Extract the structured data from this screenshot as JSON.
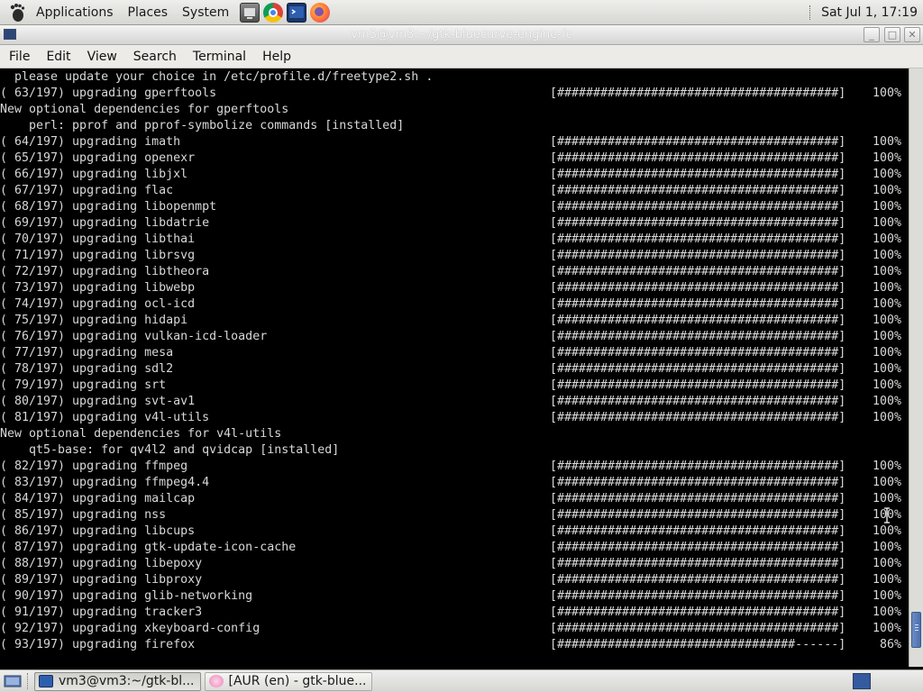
{
  "top_panel": {
    "menus": [
      "Applications",
      "Places",
      "System"
    ],
    "launchers": [
      "file-manager-icon",
      "chrome-icon",
      "terminal-icon",
      "firefox-icon"
    ],
    "clock": "Sat Jul  1, 17:19"
  },
  "window": {
    "title": "vm3@vm3:~/gtk-bluecurve-engine-fc",
    "menubar": [
      "File",
      "Edit",
      "View",
      "Search",
      "Terminal",
      "Help"
    ]
  },
  "terminal": {
    "lines": [
      {
        "text": "  please update your choice in /etc/profile.d/freetype2.sh ."
      },
      {
        "text": "( 63/197) upgrading gperftools",
        "bar": "[#######################################]",
        "pct": "100%"
      },
      {
        "text": "New optional dependencies for gperftools"
      },
      {
        "text": "    perl: pprof and pprof-symbolize commands [installed]"
      },
      {
        "text": "( 64/197) upgrading imath",
        "bar": "[#######################################]",
        "pct": "100%"
      },
      {
        "text": "( 65/197) upgrading openexr",
        "bar": "[#######################################]",
        "pct": "100%"
      },
      {
        "text": "( 66/197) upgrading libjxl",
        "bar": "[#######################################]",
        "pct": "100%"
      },
      {
        "text": "( 67/197) upgrading flac",
        "bar": "[#######################################]",
        "pct": "100%"
      },
      {
        "text": "( 68/197) upgrading libopenmpt",
        "bar": "[#######################################]",
        "pct": "100%"
      },
      {
        "text": "( 69/197) upgrading libdatrie",
        "bar": "[#######################################]",
        "pct": "100%"
      },
      {
        "text": "( 70/197) upgrading libthai",
        "bar": "[#######################################]",
        "pct": "100%"
      },
      {
        "text": "( 71/197) upgrading librsvg",
        "bar": "[#######################################]",
        "pct": "100%"
      },
      {
        "text": "( 72/197) upgrading libtheora",
        "bar": "[#######################################]",
        "pct": "100%"
      },
      {
        "text": "( 73/197) upgrading libwebp",
        "bar": "[#######################################]",
        "pct": "100%"
      },
      {
        "text": "( 74/197) upgrading ocl-icd",
        "bar": "[#######################################]",
        "pct": "100%"
      },
      {
        "text": "( 75/197) upgrading hidapi",
        "bar": "[#######################################]",
        "pct": "100%"
      },
      {
        "text": "( 76/197) upgrading vulkan-icd-loader",
        "bar": "[#######################################]",
        "pct": "100%"
      },
      {
        "text": "( 77/197) upgrading mesa",
        "bar": "[#######################################]",
        "pct": "100%"
      },
      {
        "text": "( 78/197) upgrading sdl2",
        "bar": "[#######################################]",
        "pct": "100%"
      },
      {
        "text": "( 79/197) upgrading srt",
        "bar": "[#######################################]",
        "pct": "100%"
      },
      {
        "text": "( 80/197) upgrading svt-av1",
        "bar": "[#######################################]",
        "pct": "100%"
      },
      {
        "text": "( 81/197) upgrading v4l-utils",
        "bar": "[#######################################]",
        "pct": "100%"
      },
      {
        "text": "New optional dependencies for v4l-utils"
      },
      {
        "text": "    qt5-base: for qv4l2 and qvidcap [installed]"
      },
      {
        "text": "( 82/197) upgrading ffmpeg",
        "bar": "[#######################################]",
        "pct": "100%"
      },
      {
        "text": "( 83/197) upgrading ffmpeg4.4",
        "bar": "[#######################################]",
        "pct": "100%"
      },
      {
        "text": "( 84/197) upgrading mailcap",
        "bar": "[#######################################]",
        "pct": "100%"
      },
      {
        "text": "( 85/197) upgrading nss",
        "bar": "[#######################################]",
        "pct": "100%"
      },
      {
        "text": "( 86/197) upgrading libcups",
        "bar": "[#######################################]",
        "pct": "100%"
      },
      {
        "text": "( 87/197) upgrading gtk-update-icon-cache",
        "bar": "[#######################################]",
        "pct": "100%"
      },
      {
        "text": "( 88/197) upgrading libepoxy",
        "bar": "[#######################################]",
        "pct": "100%"
      },
      {
        "text": "( 89/197) upgrading libproxy",
        "bar": "[#######################################]",
        "pct": "100%"
      },
      {
        "text": "( 90/197) upgrading glib-networking",
        "bar": "[#######################################]",
        "pct": "100%"
      },
      {
        "text": "( 91/197) upgrading tracker3",
        "bar": "[#######################################]",
        "pct": "100%"
      },
      {
        "text": "( 92/197) upgrading xkeyboard-config",
        "bar": "[#######################################]",
        "pct": "100%"
      },
      {
        "text": "( 93/197) upgrading firefox",
        "bar": "[#################################------]",
        "pct": "86%"
      }
    ],
    "scroll_position": 0.97,
    "scroll_visible_fraction": 0.06
  },
  "taskbar": {
    "tasks": [
      {
        "label": "vm3@vm3:~/gtk-bl...",
        "active": true
      },
      {
        "label": "[AUR (en) - gtk-blue...",
        "active": false
      }
    ]
  },
  "colors": {
    "terminal_bg": "#000000",
    "terminal_fg": "#d8d8d8",
    "panel_bg": "#e2e2de",
    "accent": "#4b6fae"
  }
}
